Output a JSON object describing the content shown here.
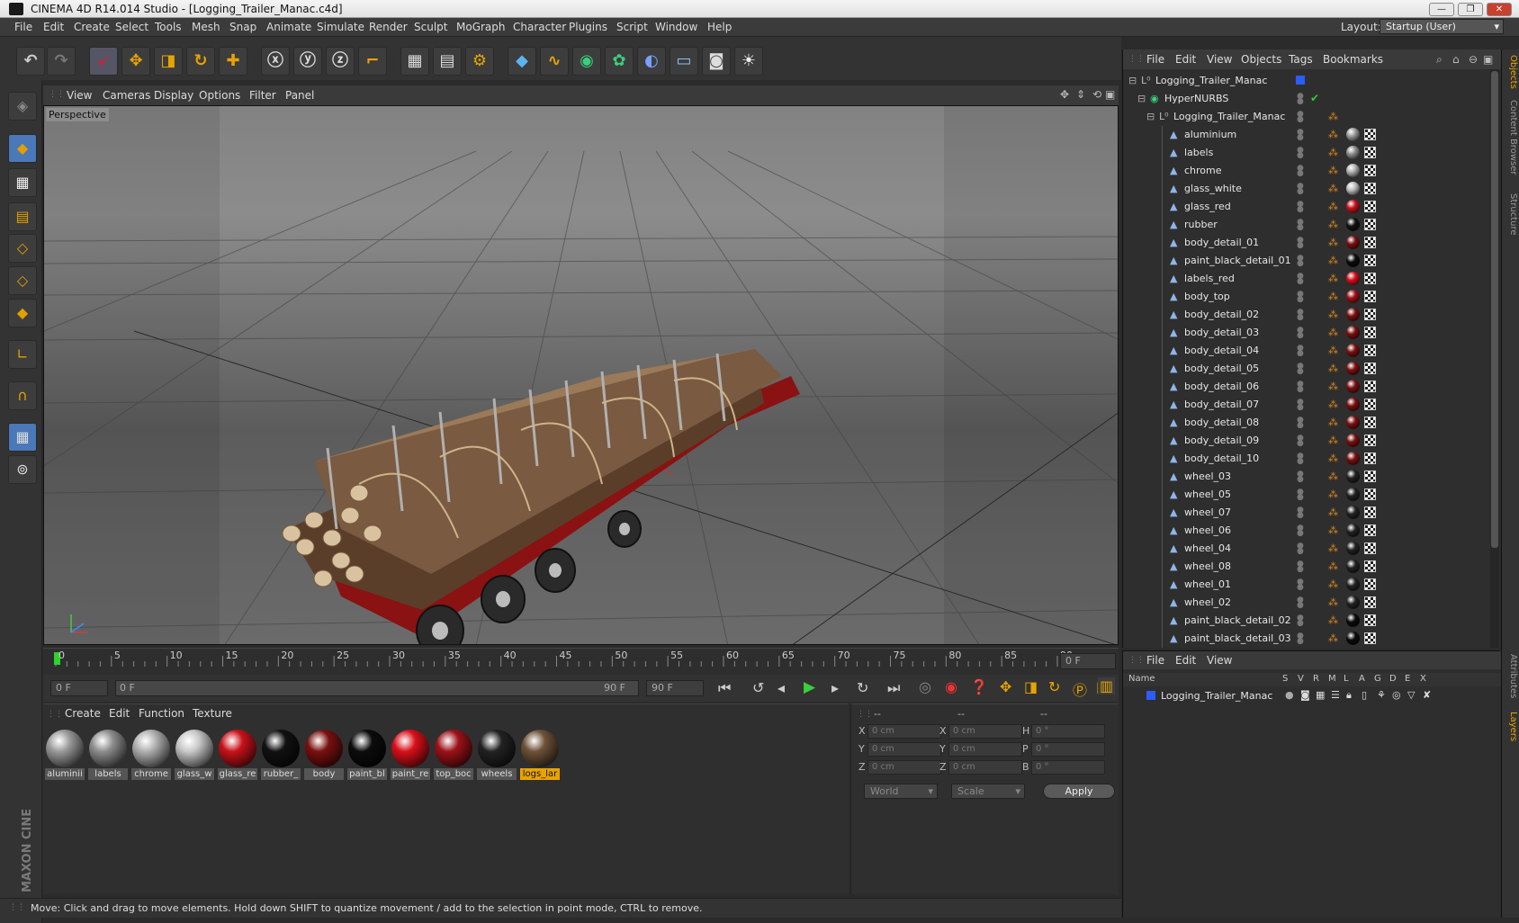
{
  "window": {
    "title": "CINEMA 4D R14.014 Studio - [Logging_Trailer_Manac.c4d]",
    "min": "—",
    "max": "❐",
    "close": "✕"
  },
  "menubar": {
    "items": [
      "File",
      "Edit",
      "Create",
      "Select",
      "Tools",
      "Mesh",
      "Snap",
      "Animate",
      "Simulate",
      "Render",
      "Sculpt",
      "MoGraph",
      "Character",
      "Plugins",
      "Script",
      "Window",
      "Help"
    ],
    "layout_label": "Layout:",
    "layout_value": "Startup (User)"
  },
  "viewport": {
    "menu": [
      "View",
      "Cameras",
      "Display",
      "Options",
      "Filter",
      "Panel"
    ],
    "label": "Perspective"
  },
  "timeline": {
    "ticks": [
      "0",
      "5",
      "10",
      "15",
      "20",
      "25",
      "30",
      "35",
      "40",
      "45",
      "50",
      "55",
      "60",
      "65",
      "70",
      "75",
      "80",
      "85",
      "90"
    ],
    "current_frame": "0 F",
    "start_field": "0 F",
    "range_start": "0 F",
    "range_end": "90 F",
    "end_field": "90 F"
  },
  "materials": {
    "menu": [
      "Create",
      "Edit",
      "Function",
      "Texture"
    ],
    "items": [
      {
        "name": "aluminii",
        "color": "#9a9a9a"
      },
      {
        "name": "labels",
        "color": "#8d8d8d"
      },
      {
        "name": "chrome",
        "color": "#b0b0b0"
      },
      {
        "name": "glass_w",
        "color": "#c8c8c8"
      },
      {
        "name": "glass_re",
        "color": "#c8121a"
      },
      {
        "name": "rubber_",
        "color": "#111111"
      },
      {
        "name": "body",
        "color": "#7a1010"
      },
      {
        "name": "paint_bl",
        "color": "#0c0c0c"
      },
      {
        "name": "paint_re",
        "color": "#d8101a"
      },
      {
        "name": "top_boc",
        "color": "#9c1218"
      },
      {
        "name": "wheels",
        "color": "#222222"
      },
      {
        "name": "logs_lar",
        "color": "#6e5238"
      }
    ]
  },
  "coords": {
    "header": [
      "--",
      "--",
      "--"
    ],
    "rows": [
      {
        "a": "X",
        "av": "0 cm",
        "b": "X",
        "bv": "0 cm",
        "c": "H",
        "cv": "0 °"
      },
      {
        "a": "Y",
        "av": "0 cm",
        "b": "Y",
        "bv": "0 cm",
        "c": "P",
        "cv": "0 °"
      },
      {
        "a": "Z",
        "av": "0 cm",
        "b": "Z",
        "bv": "0 cm",
        "c": "B",
        "cv": "0 °"
      }
    ],
    "world": "World",
    "scale": "Scale",
    "apply": "Apply"
  },
  "objects": {
    "menu": [
      "File",
      "Edit",
      "View",
      "Objects",
      "Tags",
      "Bookmarks"
    ],
    "root": "Logging_Trailer_Manac",
    "hypernurbs": "HyperNURBS",
    "group": "Logging_Trailer_Manac",
    "children": [
      {
        "name": "aluminium",
        "mat": "#9a9a9a"
      },
      {
        "name": "labels",
        "mat": "#8d8d8d"
      },
      {
        "name": "chrome",
        "mat": "#b0b0b0"
      },
      {
        "name": "glass_white",
        "mat": "#bdbdbd"
      },
      {
        "name": "glass_red",
        "mat": "#c8121a"
      },
      {
        "name": "rubber",
        "mat": "#111111"
      },
      {
        "name": "body_detail_01",
        "mat": "#7a1010"
      },
      {
        "name": "paint_black_detail_01",
        "mat": "#0c0c0c"
      },
      {
        "name": "labels_red",
        "mat": "#d8101a"
      },
      {
        "name": "body_top",
        "mat": "#9c1218"
      },
      {
        "name": "body_detail_02",
        "mat": "#7a1010"
      },
      {
        "name": "body_detail_03",
        "mat": "#7a1010"
      },
      {
        "name": "body_detail_04",
        "mat": "#7a1010"
      },
      {
        "name": "body_detail_05",
        "mat": "#7a1010"
      },
      {
        "name": "body_detail_06",
        "mat": "#7a1010"
      },
      {
        "name": "body_detail_07",
        "mat": "#7a1010"
      },
      {
        "name": "body_detail_08",
        "mat": "#7a1010"
      },
      {
        "name": "body_detail_09",
        "mat": "#7a1010"
      },
      {
        "name": "body_detail_10",
        "mat": "#7a1010"
      },
      {
        "name": "wheel_03",
        "mat": "#222222"
      },
      {
        "name": "wheel_05",
        "mat": "#222222"
      },
      {
        "name": "wheel_07",
        "mat": "#222222"
      },
      {
        "name": "wheel_06",
        "mat": "#222222"
      },
      {
        "name": "wheel_04",
        "mat": "#222222"
      },
      {
        "name": "wheel_08",
        "mat": "#222222"
      },
      {
        "name": "wheel_01",
        "mat": "#222222"
      },
      {
        "name": "wheel_02",
        "mat": "#222222"
      },
      {
        "name": "paint_black_detail_02",
        "mat": "#0c0c0c"
      },
      {
        "name": "paint_black_detail_03",
        "mat": "#0c0c0c"
      }
    ]
  },
  "layers": {
    "menu": [
      "File",
      "Edit",
      "View"
    ],
    "columns": [
      "Name",
      "S",
      "V",
      "R",
      "M",
      "L",
      "A",
      "G",
      "D",
      "E",
      "X"
    ],
    "row": "Logging_Trailer_Manac"
  },
  "side_tabs": [
    "Objects",
    "Content Browser",
    "Structure",
    "Attributes",
    "Layers"
  ],
  "status": "Move: Click and drag to move elements. Hold down SHIFT to quantize movement / add to the selection in point mode, CTRL to remove.",
  "brand": "MAXON CINEMA 4D"
}
